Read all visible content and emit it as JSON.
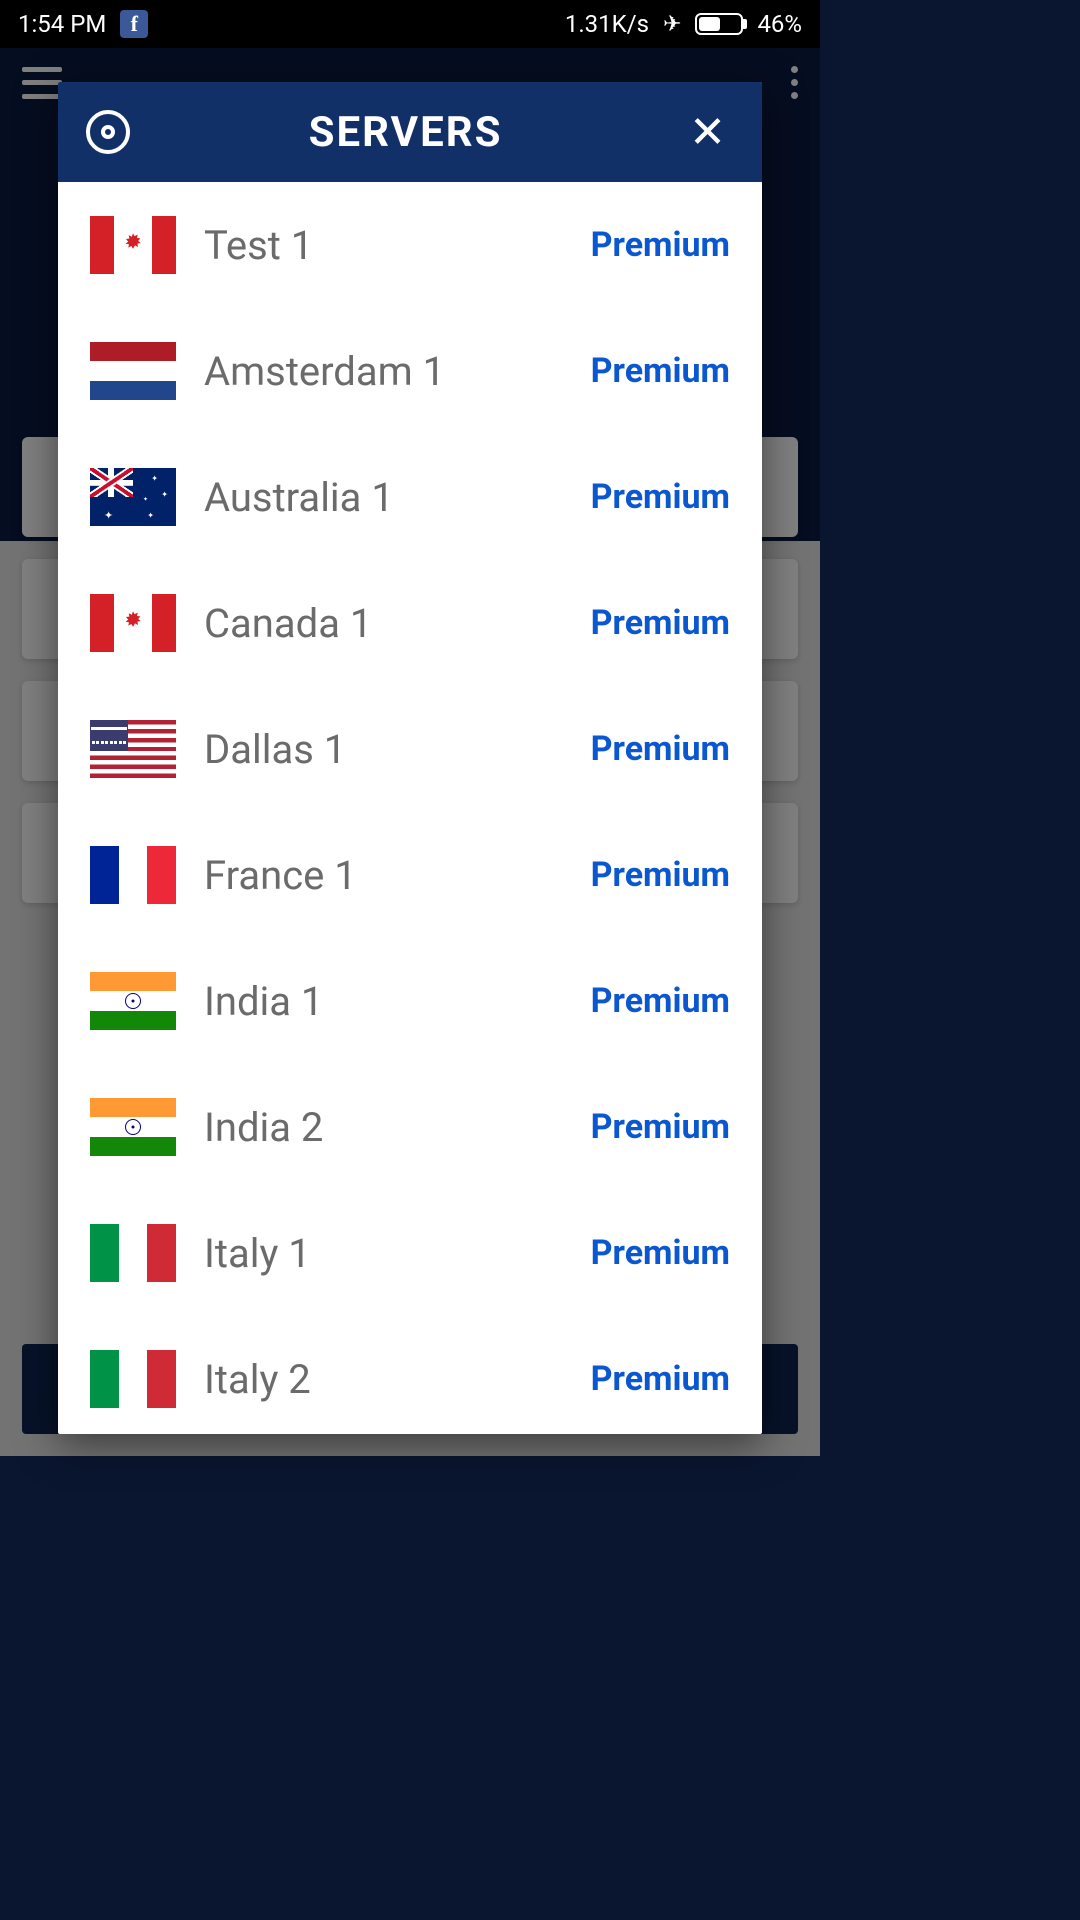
{
  "status": {
    "time": "1:54 PM",
    "speed": "1.31K/s",
    "battery_pct": "46%"
  },
  "modal": {
    "title": "SERVERS"
  },
  "premium_label": "Premium",
  "servers": [
    {
      "name": "Test 1",
      "flag": "canada",
      "premium": true
    },
    {
      "name": "Amsterdam 1",
      "flag": "netherlands",
      "premium": true
    },
    {
      "name": "Australia 1",
      "flag": "australia",
      "premium": true
    },
    {
      "name": "Canada 1",
      "flag": "canada",
      "premium": true
    },
    {
      "name": "Dallas 1",
      "flag": "usa",
      "premium": true
    },
    {
      "name": "France 1",
      "flag": "france",
      "premium": true
    },
    {
      "name": "India 1",
      "flag": "india",
      "premium": true
    },
    {
      "name": "India 2",
      "flag": "india",
      "premium": true
    },
    {
      "name": "Italy 1",
      "flag": "italy",
      "premium": true
    },
    {
      "name": "Italy 2",
      "flag": "italy",
      "premium": true
    }
  ]
}
